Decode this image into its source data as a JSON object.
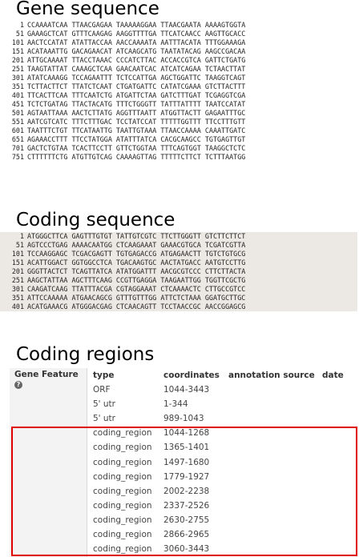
{
  "headings": {
    "gene": "Gene sequence",
    "coding": "Coding sequence",
    "regions": "Coding regions"
  },
  "gene_sequence": [
    {
      "num": "1",
      "seq": "CCAAAATCAA TTAACGAGAA TAAAAAGGAA TTAACGAATA AAAAGTGGTA"
    },
    {
      "num": "51",
      "seq": "GAAAGCTCAT GTTTCAAGAG AAGGTTTTGA TTCATCAACC AAGTTGCACC"
    },
    {
      "num": "101",
      "seq": "AACTCCATAT ATATTACCAA AACCAAAATA AATTTACATA TTTGGAAAGA"
    },
    {
      "num": "151",
      "seq": "ACATAAATTG GACAGAACAT ATCAAGCATG TAATATACAG AAGCCGACAA"
    },
    {
      "num": "201",
      "seq": "ATTGCAAAAT TTACCTAAAC CCCATCTTAC ACCACCGTCA GATTCTGATG"
    },
    {
      "num": "251",
      "seq": "TAAGTATTAT CAAAGCTCAA GAACAATCAC ATCATCAGAA TCTAACTTAT"
    },
    {
      "num": "301",
      "seq": "ATATCAAAGG TCCAGAATTT TCTCCATTGA AGCTGGATTC TAAGGTCAGT"
    },
    {
      "num": "351",
      "seq": "TCTTACTTCT TTATCTCAAT CTGATGATTC CATATCGAAA GTCTTACTTT"
    },
    {
      "num": "401",
      "seq": "TTCACTTCAA TTTCAATCTG ATGATTCTAA GATCTTTGAT TCGAGGTCGA"
    },
    {
      "num": "451",
      "seq": "TCTCTGATAG TTACTACATG TTTCTGGGTT TATTTATTTT TAATCCATAT"
    },
    {
      "num": "501",
      "seq": "AGTAATTAAA AACTCTTATG AGGTTTAATT ATGGTTACTT GAGAATTTGC"
    },
    {
      "num": "551",
      "seq": "AATCGTCATC TTTCTTTGAC TCCTATCCAT TTTTTGGTTT TTCCTTTGTT"
    },
    {
      "num": "601",
      "seq": "TAATTTCTGT TTCATAATTG TAATTGTAAA TTAACCAAAA CAAATTGATC"
    },
    {
      "num": "651",
      "seq": "AGAAACCTTT TTCCTATGGA ATATTTATCA CACGCAAGCC TGTGAGTTGT"
    },
    {
      "num": "701",
      "seq": "GACTCTGTAA TCACTTCCTT GTTCTGGTAA TTTCAGTGGT TAAGGCTCTC"
    },
    {
      "num": "751",
      "seq": "CTTTTTTCTG ATGTTGTCAG CAAAAGTTAG TTTTTCTTCT TCTTTAATGG"
    }
  ],
  "coding_sequence": [
    {
      "num": "1",
      "seq": "ATGGGCTTCA GAGTTTGTGT TATTGTCGTC TTCTTGGGTT GTCTTCTTCT"
    },
    {
      "num": "51",
      "seq": "AGTCCCTGAG AAAACAATGG CTCAAGAAAT GAAACGTGCA TCGATCGTTA"
    },
    {
      "num": "101",
      "seq": "TCCAAGGAGC TCGACGAGTT TGTGAGACCG ATGAGAACTT TGTCTGTGCG"
    },
    {
      "num": "151",
      "seq": "ACATTGGACT GGTGGCCTCA TGACAAGTGC AACTATGACC AATGTCCTTG"
    },
    {
      "num": "201",
      "seq": "GGGTTACTCT TCAGTTATCA ATATGGATTT AACGCGTCCC CTTCTTACTA"
    },
    {
      "num": "251",
      "seq": "AAGCTATTAA AGCTTTCAAG CCGTTGAGGA TAAGAATTGG TGGTTCGCTG"
    },
    {
      "num": "301",
      "seq": "CAAGATCAAG TTATTTACGA CGTAGGAAAT CTCAAAACTC CTTGCCGTCC"
    },
    {
      "num": "351",
      "seq": "ATTCCAAAAA ATGAACAGCG GTTTGTTTGG ATTCTCTAAA GGATGCTTGC"
    },
    {
      "num": "401",
      "seq": "ACATGAAACG ATGGGACGAG CTCAACAGTT TCCTAACCGC AACCGGAGCG"
    }
  ],
  "table": {
    "gene_feature_label": "Gene Feature",
    "help_icon": "question-circle-icon",
    "headers": {
      "type": "type",
      "coordinates": "coordinates",
      "annotation_source": "annotation source",
      "date": "date"
    },
    "rows": [
      {
        "type": "ORF",
        "coordinates": "1044-3443"
      },
      {
        "type": "5' utr",
        "coordinates": "1-344"
      },
      {
        "type": "5' utr",
        "coordinates": "989-1043"
      },
      {
        "type": "coding_region",
        "coordinates": "1044-1268"
      },
      {
        "type": "coding_region",
        "coordinates": "1365-1401"
      },
      {
        "type": "coding_region",
        "coordinates": "1497-1680"
      },
      {
        "type": "coding_region",
        "coordinates": "1779-1927"
      },
      {
        "type": "coding_region",
        "coordinates": "2002-2238"
      },
      {
        "type": "coding_region",
        "coordinates": "2337-2526"
      },
      {
        "type": "coding_region",
        "coordinates": "2630-2755"
      },
      {
        "type": "coding_region",
        "coordinates": "2866-2965"
      },
      {
        "type": "coding_region",
        "coordinates": "3060-3443"
      }
    ],
    "highlight_color": "#e00000"
  }
}
